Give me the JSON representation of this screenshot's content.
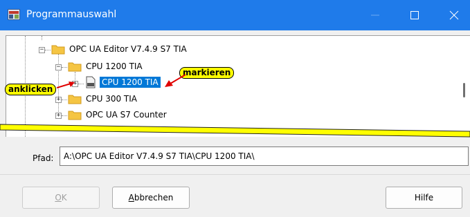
{
  "window": {
    "title": "Programmauswahl",
    "title_bar_color": "#1f7bea",
    "buttons": [
      "minimize",
      "maximize",
      "close"
    ]
  },
  "tree": {
    "nodes": [
      {
        "label": "OPC UA Editor V7.4.9 S7 TIA",
        "icon": "folder-icon",
        "expander": "minus"
      },
      {
        "label": "CPU 1200 TIA",
        "icon": "folder-icon",
        "expander": "minus"
      },
      {
        "label": "CPU 1200 TIA",
        "icon": "pdf-document-icon",
        "expander": "plus",
        "selected": true
      },
      {
        "label": "CPU 300 TIA",
        "icon": "folder-icon",
        "expander": "plus"
      },
      {
        "label": "OPC UA S7 Counter",
        "icon": "folder-icon",
        "expander": "plus"
      }
    ],
    "selection_color": "#0078d7"
  },
  "annotations": {
    "click_label": "anklicken",
    "mark_label": "markieren",
    "highlight_color": "#ffff00",
    "arrow_color": "#e00000"
  },
  "path": {
    "label": "Pfad:",
    "value": "A:\\OPC UA Editor V7.4.9 S7 TIA\\CPU 1200 TIA\\"
  },
  "buttons": {
    "ok": {
      "mnemonic": "O",
      "rest": "K"
    },
    "cancel": {
      "mnemonic": "A",
      "rest": "bbrechen"
    },
    "help": "Hilfe"
  }
}
